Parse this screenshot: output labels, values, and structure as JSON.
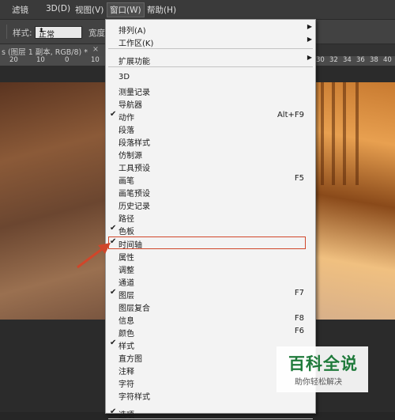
{
  "menubar": {
    "items": [
      {
        "name": "menu-filter",
        "label": "滤镜"
      },
      {
        "name": "menu-3d",
        "label": "3D(D)"
      },
      {
        "name": "menu-view",
        "label": "视图(V)"
      },
      {
        "name": "menu-window",
        "label": "窗口(W)"
      },
      {
        "name": "menu-help",
        "label": "帮助(H)"
      }
    ]
  },
  "options": {
    "style_label": "样式:",
    "style_value": "正常",
    "width_label": "宽度"
  },
  "document_tab": {
    "title": "s (图层 1 副本, RGB/8) *",
    "close": "×"
  },
  "rulers": {
    "left_numbers": [
      "20",
      "10",
      "0",
      "10"
    ],
    "right_numbers": [
      "30",
      "32",
      "34",
      "36",
      "38",
      "40"
    ]
  },
  "window_menu": {
    "check_glyph": "✔",
    "submenu_glyph": "▶",
    "items": [
      {
        "label": "排列(A)",
        "submenu": true
      },
      {
        "label": "工作区(K)",
        "submenu": true
      },
      {
        "label": "扩展功能",
        "submenu": true
      },
      {
        "label": "3D"
      },
      {
        "label": "测量记录"
      },
      {
        "label": "导航器"
      },
      {
        "label": "动作",
        "checked": true,
        "shortcut": "Alt+F9"
      },
      {
        "label": "段落"
      },
      {
        "label": "段落样式"
      },
      {
        "label": "仿制源"
      },
      {
        "label": "工具预设"
      },
      {
        "label": "画笔",
        "shortcut": "F5"
      },
      {
        "label": "画笔预设"
      },
      {
        "label": "历史记录"
      },
      {
        "label": "路径"
      },
      {
        "label": "色板",
        "checked": true
      },
      {
        "label": "时间轴",
        "checked": true,
        "highlighted": true
      },
      {
        "label": "属性"
      },
      {
        "label": "调整"
      },
      {
        "label": "通道"
      },
      {
        "label": "图层",
        "checked": true,
        "shortcut": "F7"
      },
      {
        "label": "图层复合"
      },
      {
        "label": "信息",
        "shortcut": "F8"
      },
      {
        "label": "颜色",
        "shortcut": "F6"
      },
      {
        "label": "样式",
        "checked": true
      },
      {
        "label": "直方图"
      },
      {
        "label": "注释"
      },
      {
        "label": "字符"
      },
      {
        "label": "字符样式"
      },
      {
        "label": "选项",
        "checked": true
      }
    ]
  },
  "watermark": {
    "brand": "百科全说",
    "tagline": "助你轻松解决"
  },
  "colors": {
    "highlight_border": "#d0462a",
    "watermark_green": "#1f7a3b"
  }
}
